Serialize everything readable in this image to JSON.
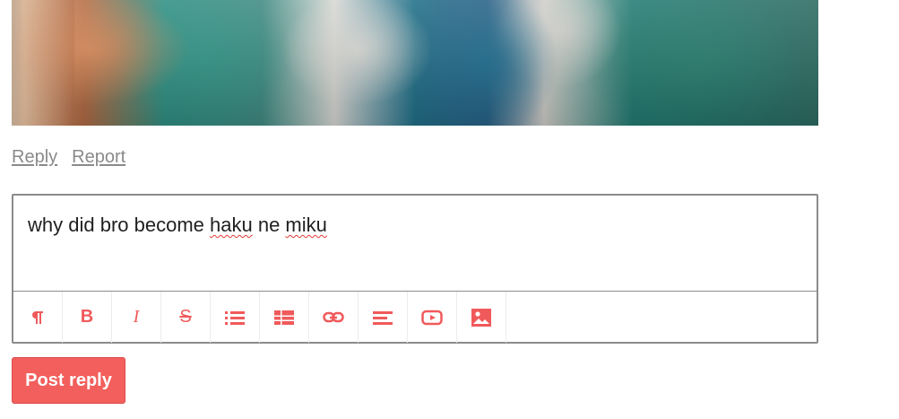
{
  "links": {
    "reply": "Reply",
    "report": "Report"
  },
  "editor": {
    "text_segments": [
      "why did bro become ",
      "haku",
      " ne ",
      "miku"
    ]
  },
  "toolbar": {
    "icons": [
      "paragraph-icon",
      "bold-icon",
      "italic-icon",
      "strikethrough-icon",
      "list-icon",
      "table-icon",
      "link-icon",
      "align-icon",
      "video-icon",
      "image-icon"
    ],
    "bold_glyph": "B",
    "italic_glyph": "I",
    "strike_glyph": "S"
  },
  "button": {
    "post_reply": "Post reply"
  },
  "colors": {
    "accent": "#f25f5c",
    "muted_text": "#8a8a8a",
    "border": "#8b8b8b",
    "spellcheck": "#e53935"
  }
}
